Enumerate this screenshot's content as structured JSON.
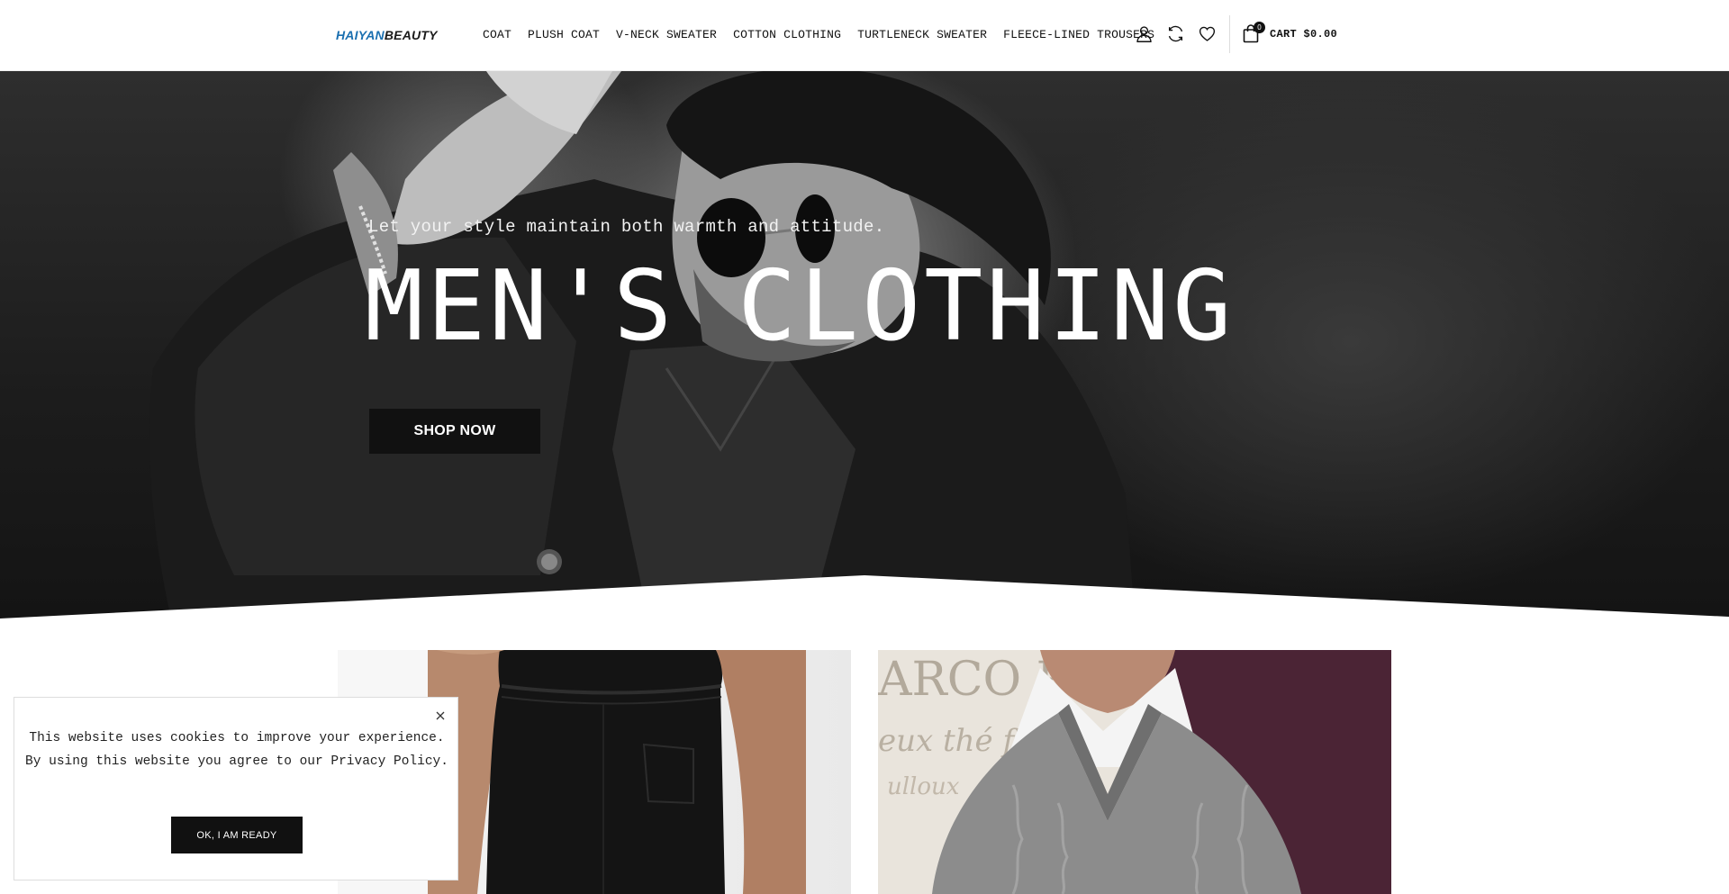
{
  "header": {
    "logo": {
      "part1": "HAIYAN",
      "part2": "BEAUTY"
    },
    "nav": [
      {
        "label": "COAT"
      },
      {
        "label": "PLUSH COAT"
      },
      {
        "label": "V-NECK SWEATER"
      },
      {
        "label": "COTTON CLOTHING"
      },
      {
        "label": "TURTLENECK SWEATER"
      },
      {
        "label": "FLEECE-LINED TROUSERS"
      }
    ],
    "icons": [
      "account-icon",
      "compare-icon",
      "wishlist-icon"
    ],
    "cart": {
      "count": "0",
      "label": "CART $0.00"
    }
  },
  "hero": {
    "subtitle": "Let your style maintain both warmth and attitude.",
    "title": "MEN'S CLOTHING",
    "button": "SHOP NOW"
  },
  "cookie": {
    "line1": "This website uses cookies to improve your experience.",
    "line2": "By using this website you agree to our Privacy Policy.",
    "button": "OK, I AM READY"
  },
  "colors": {
    "brand_blue": "#1a6fb0",
    "dark": "#111111",
    "white": "#ffffff"
  }
}
